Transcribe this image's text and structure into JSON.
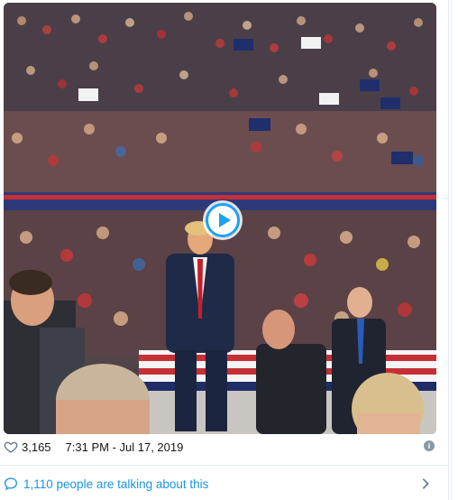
{
  "media": {
    "type": "video",
    "play_icon": "play-icon",
    "accent": "#1da1f2"
  },
  "stats": {
    "likes": "3,165",
    "timestamp": "7:31 PM - Jul 17, 2019",
    "heart_icon": "heart-icon",
    "info_icon": "info-icon"
  },
  "conversation": {
    "label": "1,110 people are talking about this",
    "bubble_icon": "chat-bubble-icon",
    "chevron_icon": "chevron-right-icon",
    "link_color": "#1b95e0"
  }
}
